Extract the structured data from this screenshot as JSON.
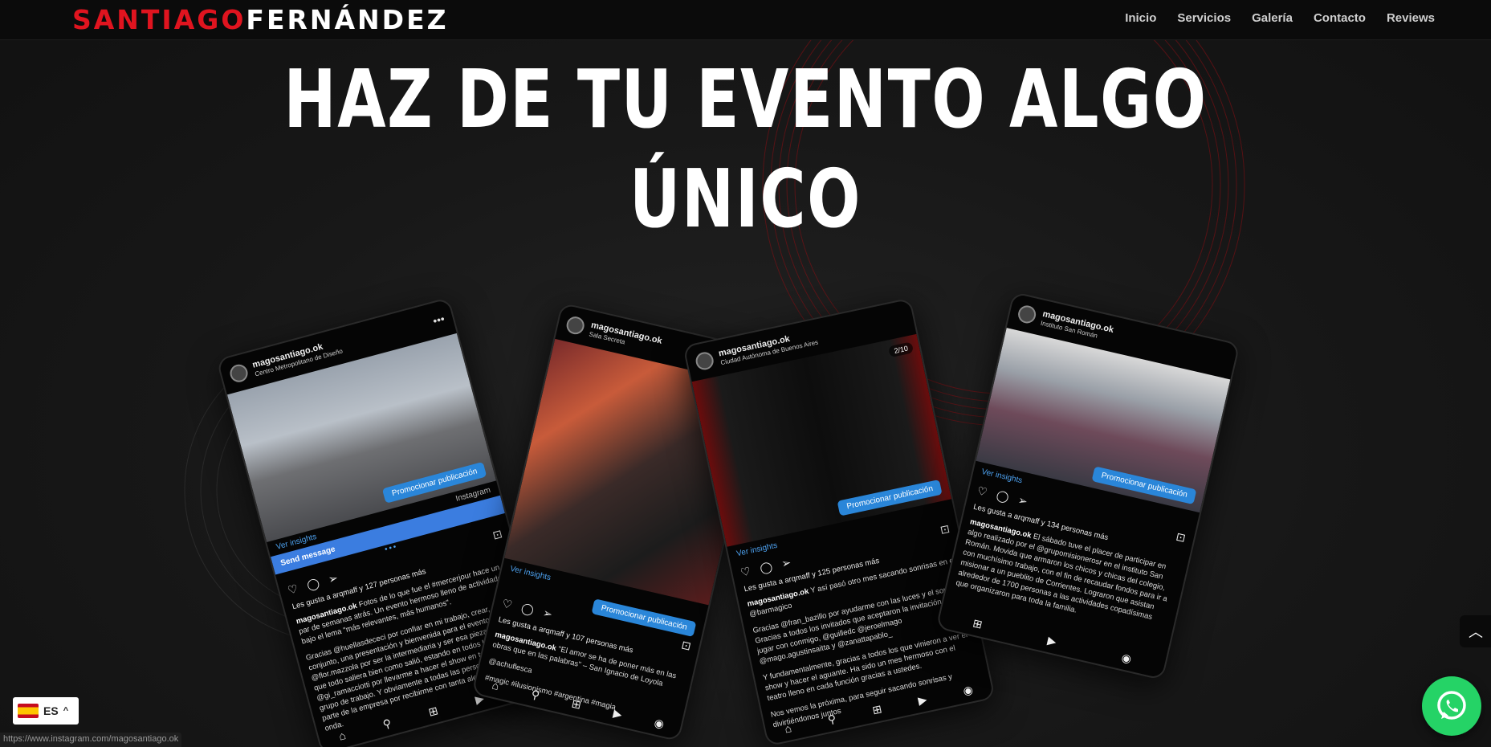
{
  "header": {
    "logo_first": "SANTIAGO",
    "logo_last": "FERNÁNDEZ",
    "nav": [
      "Inicio",
      "Servicios",
      "Galería",
      "Contacto",
      "Reviews"
    ]
  },
  "hero": {
    "line1": "HAZ DE TU EVENTO ALGO",
    "line2": "ÚNICO"
  },
  "posts": [
    {
      "user": "magosantiago.ok",
      "location": "Centro Metropolitano de Diseño",
      "promo": "Promocionar publicación",
      "insights": "Ver insights",
      "source": "Instagram",
      "send_message": "Send message",
      "likes": "Les gusta a arqmaff y 127 personas más",
      "caption_user": "magosantiago.ok",
      "caption": "Fotos de lo que fue el #mercerjour hace un par de semanas atrás. Un evento hermoso lleno de actividades bajo el lema \"más relevantes, más humanos\".",
      "caption2": "Gracias @huellasdececi por confiar en mi trabajo, crear, en conjunto, una presentación y bienvenida para el evento. Gracias @flor.mazzola por ser la intermediaria y ser esa pieza clave para que todo saliera bien como salió, estando en todos los detalles. @gi_ramacciotti por llevarme a hacer el show en tan hermoso grupo de trabajo. Y obviamente a todas las personas que forman parte de la empresa por recibirme con tanta alegría y buena onda."
    },
    {
      "user": "magosantiago.ok",
      "location": "Sala Secreta",
      "promo": "Promocionar publicación",
      "insights": "Ver insights",
      "likes": "Les gusta a arqmaff y 107 personas más",
      "caption_user": "magosantiago.ok",
      "caption": "\"El amor se ha de poner más en las obras que en las palabras\" – San Ignacio de Loyola",
      "tag": "@achuflesca",
      "hashtags": "#magic #ilusionismo #argentina #magia"
    },
    {
      "user": "magosantiago.ok",
      "location": "Ciudad Autónoma de Buenos Aires",
      "counter": "2/10",
      "promo": "Promocionar publicación",
      "insights": "Ver insights",
      "likes": "Les gusta a arqmaff y 125 personas más",
      "caption_user": "magosantiago.ok",
      "caption": "Y así pasó otro mes sacando sonrisas en el @barmagico",
      "caption2": "Gracias @fran_bazillo por ayudarme con las luces y el sonido. Gracias a todos los invitados que aceptaron la invitación a jugar con conmigo, @guilledc @jeroelmago @mago.agustinsaitta y @zanattapablo_",
      "caption3": "Y fundamentalmente, gracias a todos los que vinieron a ver el show y hacer el aguante. Ha sido un mes hermoso con el teatro lleno en cada función gracias a ustedes.",
      "caption4": "Nos vemos la próxima, para seguir sacando sonrisas y divirtiéndonos juntos"
    },
    {
      "user": "magosantiago.ok",
      "location": "Instituto San Román",
      "promo": "Promocionar publicación",
      "insights": "Ver insights",
      "likes": "Les gusta a arqmaff y 134 personas más",
      "caption_user": "magosantiago.ok",
      "caption": "El sábado tuve el placer de participar en algo realizado por el @grupomisionerosr en el instituto San Román. Movida que armaron los chicos y chicas del colegio, con muchísimo trabajo, con el fin de recaudar fondos para ir a misionar a un pueblito de Corrientes. Lograron que asistan alrededor de 1700 personas a las actividades copadísimas que organizaron para toda la familia."
    }
  ],
  "widgets": {
    "lang": "ES",
    "status_url": "https://www.instagram.com/magosantiago.ok",
    "colors": {
      "brand_red": "#e0141f",
      "whatsapp": "#25d366",
      "promo_blue": "#2a86d9"
    }
  }
}
